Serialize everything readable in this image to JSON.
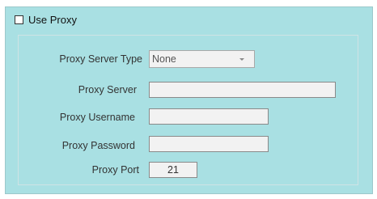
{
  "proxy": {
    "use_proxy_label": "Use Proxy",
    "use_proxy_checked": false,
    "server_type_label": "Proxy Server Type",
    "server_type_value": "None",
    "server_label": "Proxy Server",
    "server_value": "",
    "username_label": "Proxy Username",
    "username_value": "",
    "password_label": "Proxy Password",
    "password_value": "",
    "port_label": "Proxy Port",
    "port_value": "21"
  }
}
